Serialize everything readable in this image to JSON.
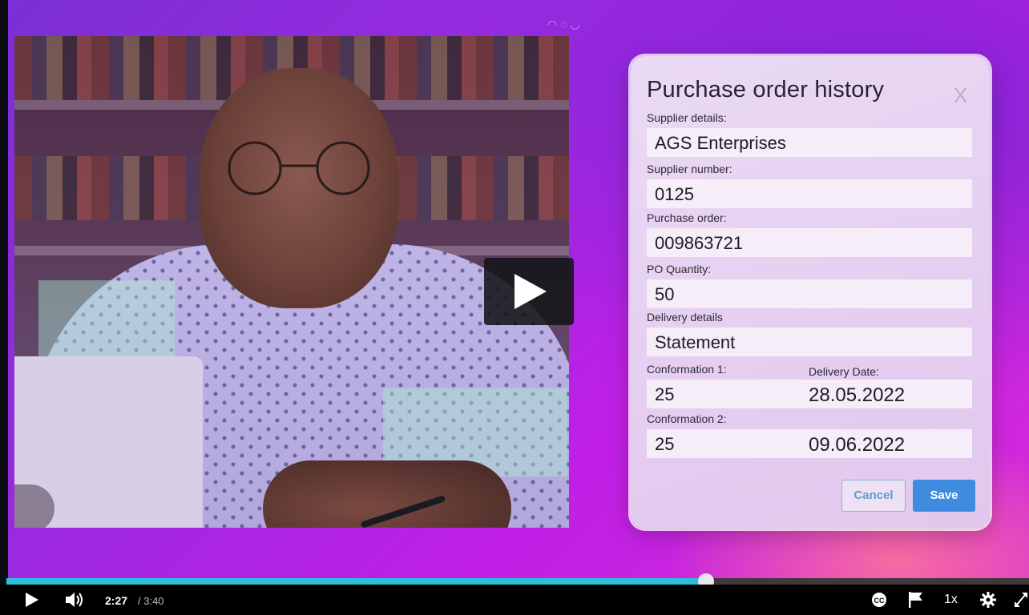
{
  "video": {
    "play_overlay_icon": "play-icon",
    "progress_fraction": 0.684
  },
  "form": {
    "title": "Purchase order history",
    "close_label": "X",
    "supplier_details_label": "Supplier details:",
    "supplier_details_value": "AGS Enterprises",
    "supplier_number_label": "Supplier number:",
    "supplier_number_value": "0125",
    "purchase_order_label": "Purchase order:",
    "purchase_order_value": "009863721",
    "po_quantity_label": "PO Quantity:",
    "po_quantity_value": "50",
    "delivery_details_label": "Delivery details",
    "delivery_details_value": "Statement",
    "conformation1_label": "Conformation 1:",
    "delivery_date_label": "Delivery Date:",
    "conformation1_value": "25",
    "conformation1_date": "28.05.2022",
    "conformation2_label": "Conformation 2:",
    "conformation2_value": "25",
    "conformation2_date": "09.06.2022",
    "cancel_label": "Cancel",
    "save_label": "Save"
  },
  "player": {
    "current_time": "2:27",
    "total_time": "/ 3:40",
    "speed": "1x",
    "icons": [
      "play-icon",
      "volume-icon",
      "captions-icon",
      "flag-icon",
      "settings-gear-icon",
      "fullscreen-icon"
    ]
  },
  "colors": {
    "progress": "#2ec0d8",
    "save_button": "#3f8be0",
    "cancel_text": "#5c9dd4"
  }
}
